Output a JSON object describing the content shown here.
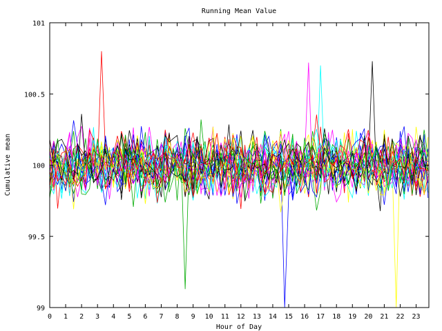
{
  "chart_data": {
    "type": "line",
    "title": "Running Mean Value",
    "xlabel": "Hour of Day",
    "ylabel": "Cumulative mean",
    "xlim": [
      0,
      23.8
    ],
    "ylim": [
      99,
      101
    ],
    "x_ticks": [
      0,
      1,
      2,
      3,
      4,
      5,
      6,
      7,
      8,
      9,
      10,
      11,
      12,
      13,
      14,
      15,
      16,
      17,
      18,
      19,
      20,
      21,
      22,
      23
    ],
    "y_ticks": [
      99,
      99.5,
      100,
      100.5,
      101
    ],
    "y_tick_labels": [
      "99",
      "99.5",
      "100",
      "100.5",
      "101"
    ],
    "grid": false,
    "legend": "none",
    "series_palette": [
      "#ff0000",
      "#00aa00",
      "#0000ff",
      "#ff00ff",
      "#00ffff",
      "#ffff00",
      "#000000"
    ],
    "series_count": 30,
    "samples_per_hour": 4,
    "center": 100,
    "typical_spread": 0.2,
    "notable_points": [
      {
        "x": 3.25,
        "y": 100.8
      },
      {
        "x": 8.5,
        "y": 99.13
      },
      {
        "x": 14.75,
        "y": 99
      },
      {
        "x": 16.25,
        "y": 100.72
      },
      {
        "x": 17.0,
        "y": 100.7
      },
      {
        "x": 21.75,
        "y": 99
      },
      {
        "x": 20.25,
        "y": 100.73
      }
    ]
  }
}
